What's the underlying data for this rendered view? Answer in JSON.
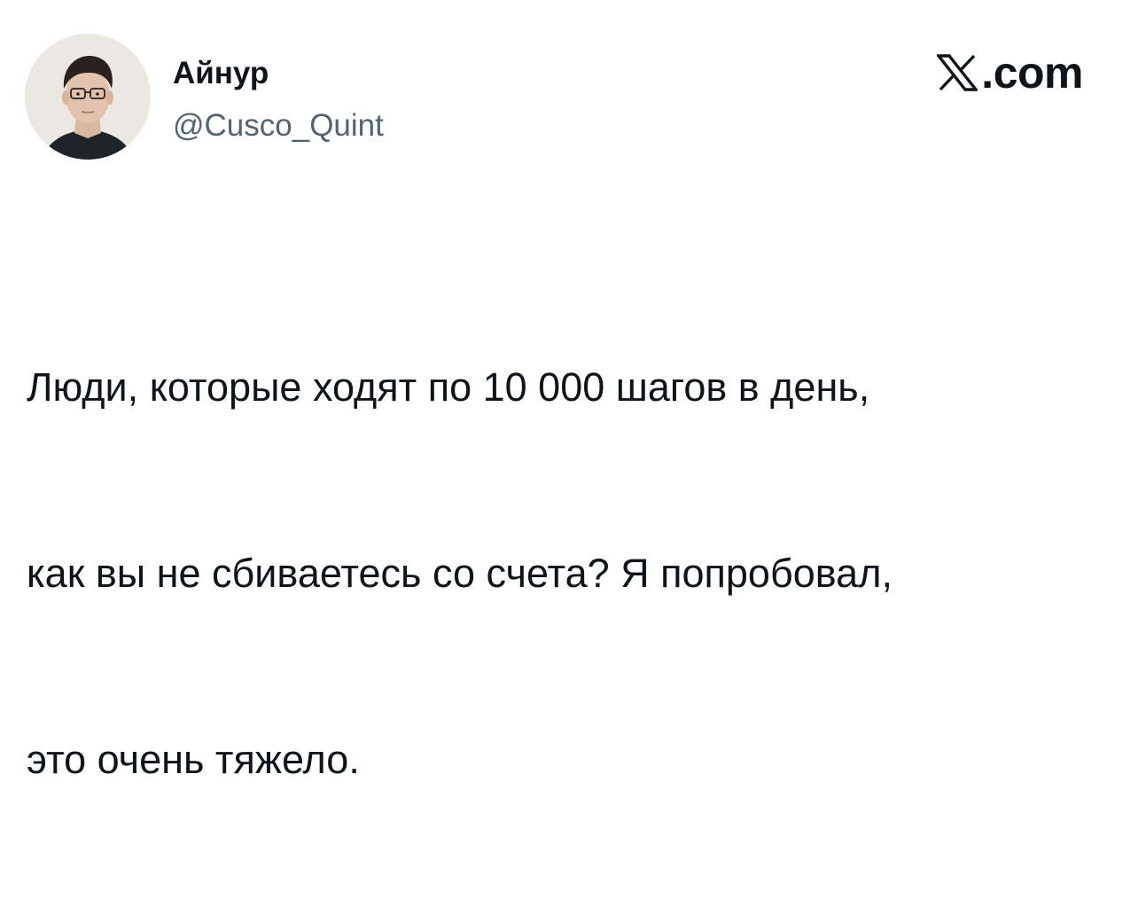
{
  "tweet": {
    "author": {
      "display_name": "Айнур",
      "handle": "@Cusco_Quint",
      "avatar": "profile-photo"
    },
    "brand": {
      "logo_icon": "x-logo-icon",
      "suffix": ".com"
    },
    "text_lines": [
      "Люди, которые ходят по 10 000 шагов в день,",
      "как вы не сбиваетесь со счета? Я попробовал,",
      "это очень тяжело."
    ]
  },
  "colors": {
    "text_primary": "#0f1419",
    "text_secondary": "#536471",
    "background": "#ffffff"
  }
}
